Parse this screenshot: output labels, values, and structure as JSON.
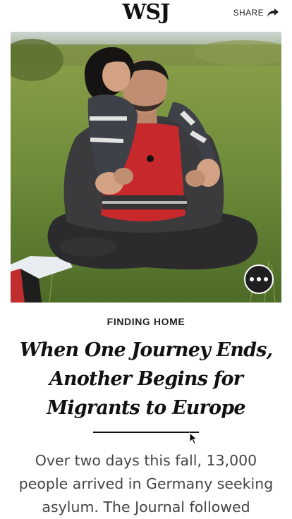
{
  "header": {
    "logo": "WSJ",
    "share_label": "SHARE"
  },
  "icons": {
    "share": "share-arrow-icon",
    "more": "more-dots-icon",
    "cursor": "mouse-pointer-icon"
  },
  "article": {
    "kicker": "FINDING HOME",
    "headline_lines": [
      "When One Journey Ends,",
      "Another Begins for",
      "Migrants to Europe"
    ],
    "dek_lines": [
      "Over two days this fall, 13,000",
      "people arrived in Germany seeking",
      "asylum. The Journal followed"
    ]
  },
  "colors": {
    "text": "#111111",
    "dek": "#444444",
    "button_bg": "#1f1f1f",
    "grass": "#6f8f3f"
  }
}
